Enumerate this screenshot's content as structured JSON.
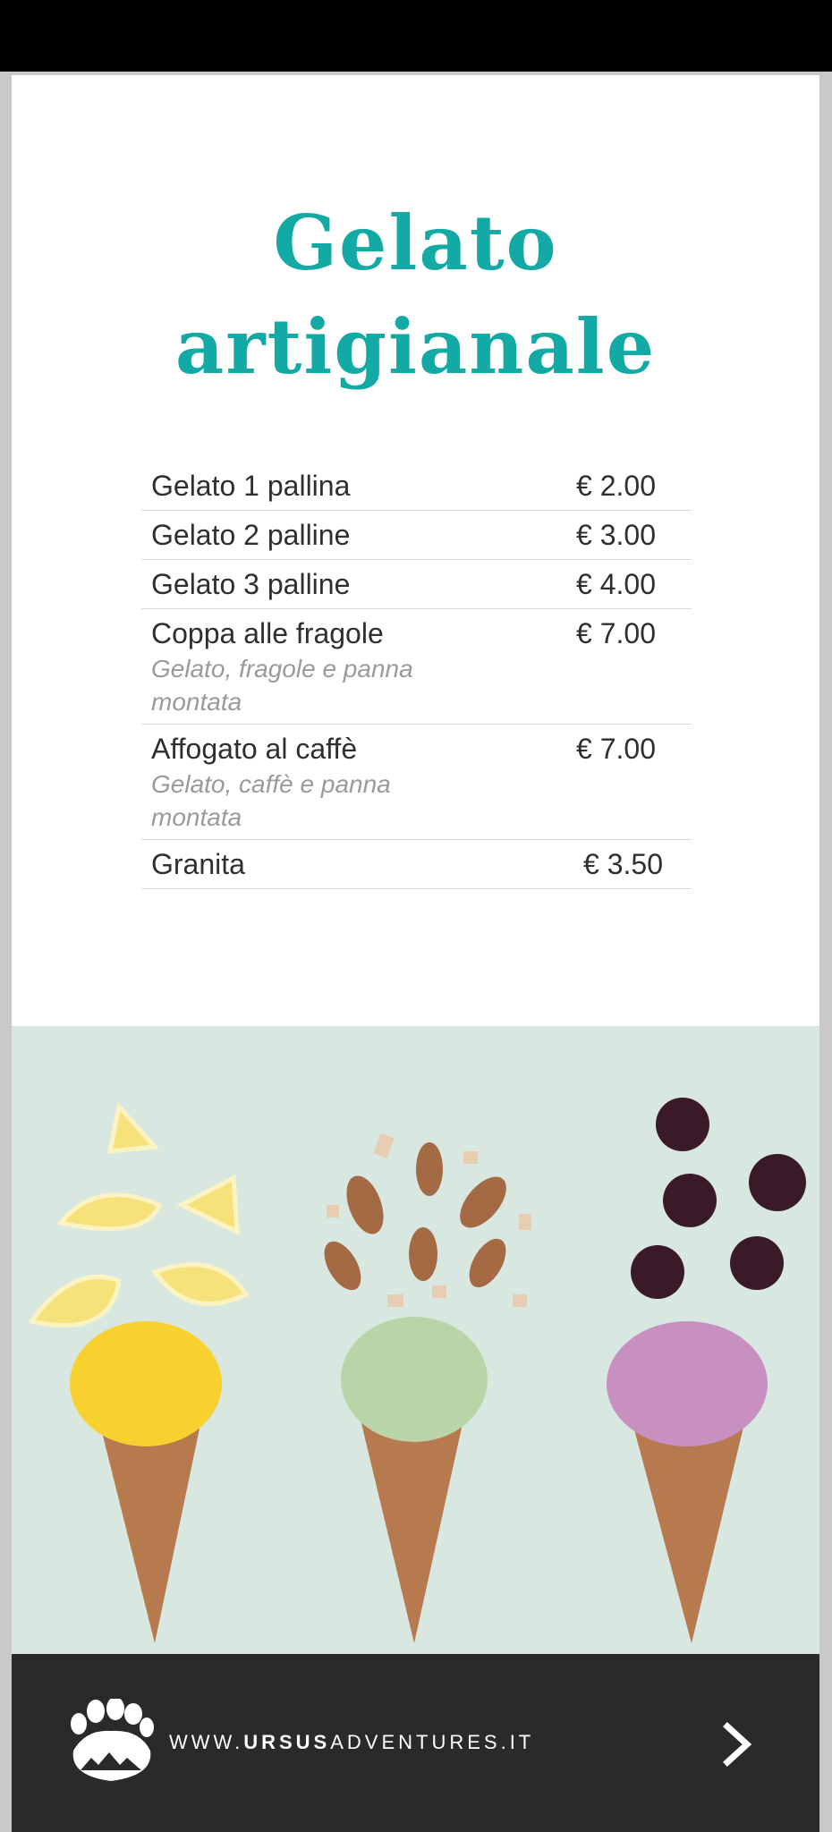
{
  "menu": {
    "title_line1": "Gelato",
    "title_line2": "artigianale",
    "items": [
      {
        "name": "Gelato 1 pallina",
        "price": "€ 2.00"
      },
      {
        "name": "Gelato 2 palline",
        "price": "€ 3.00"
      },
      {
        "name": "Gelato 3 palline",
        "price": "€ 4.00"
      },
      {
        "name": "Coppa alle fragole",
        "desc": "Gelato, fragole e panna montata",
        "price": "€ 7.00"
      },
      {
        "name": "Affogato al caffè",
        "desc": "Gelato, caffè e panna montata",
        "price": "€ 7.00"
      },
      {
        "name": "Granita",
        "price": "€ 3.50"
      }
    ]
  },
  "footer": {
    "url_prefix": "WWW.",
    "url_brand": "URSUS",
    "url_suffix": "ADVENTURES.IT",
    "logo_icon": "bear-paw-icon",
    "next_icon": "chevron-right-icon"
  },
  "colors": {
    "accent": "#13aaa6",
    "footer_bg": "#2a2a2a",
    "photo_bg": "#d9e7e1"
  }
}
